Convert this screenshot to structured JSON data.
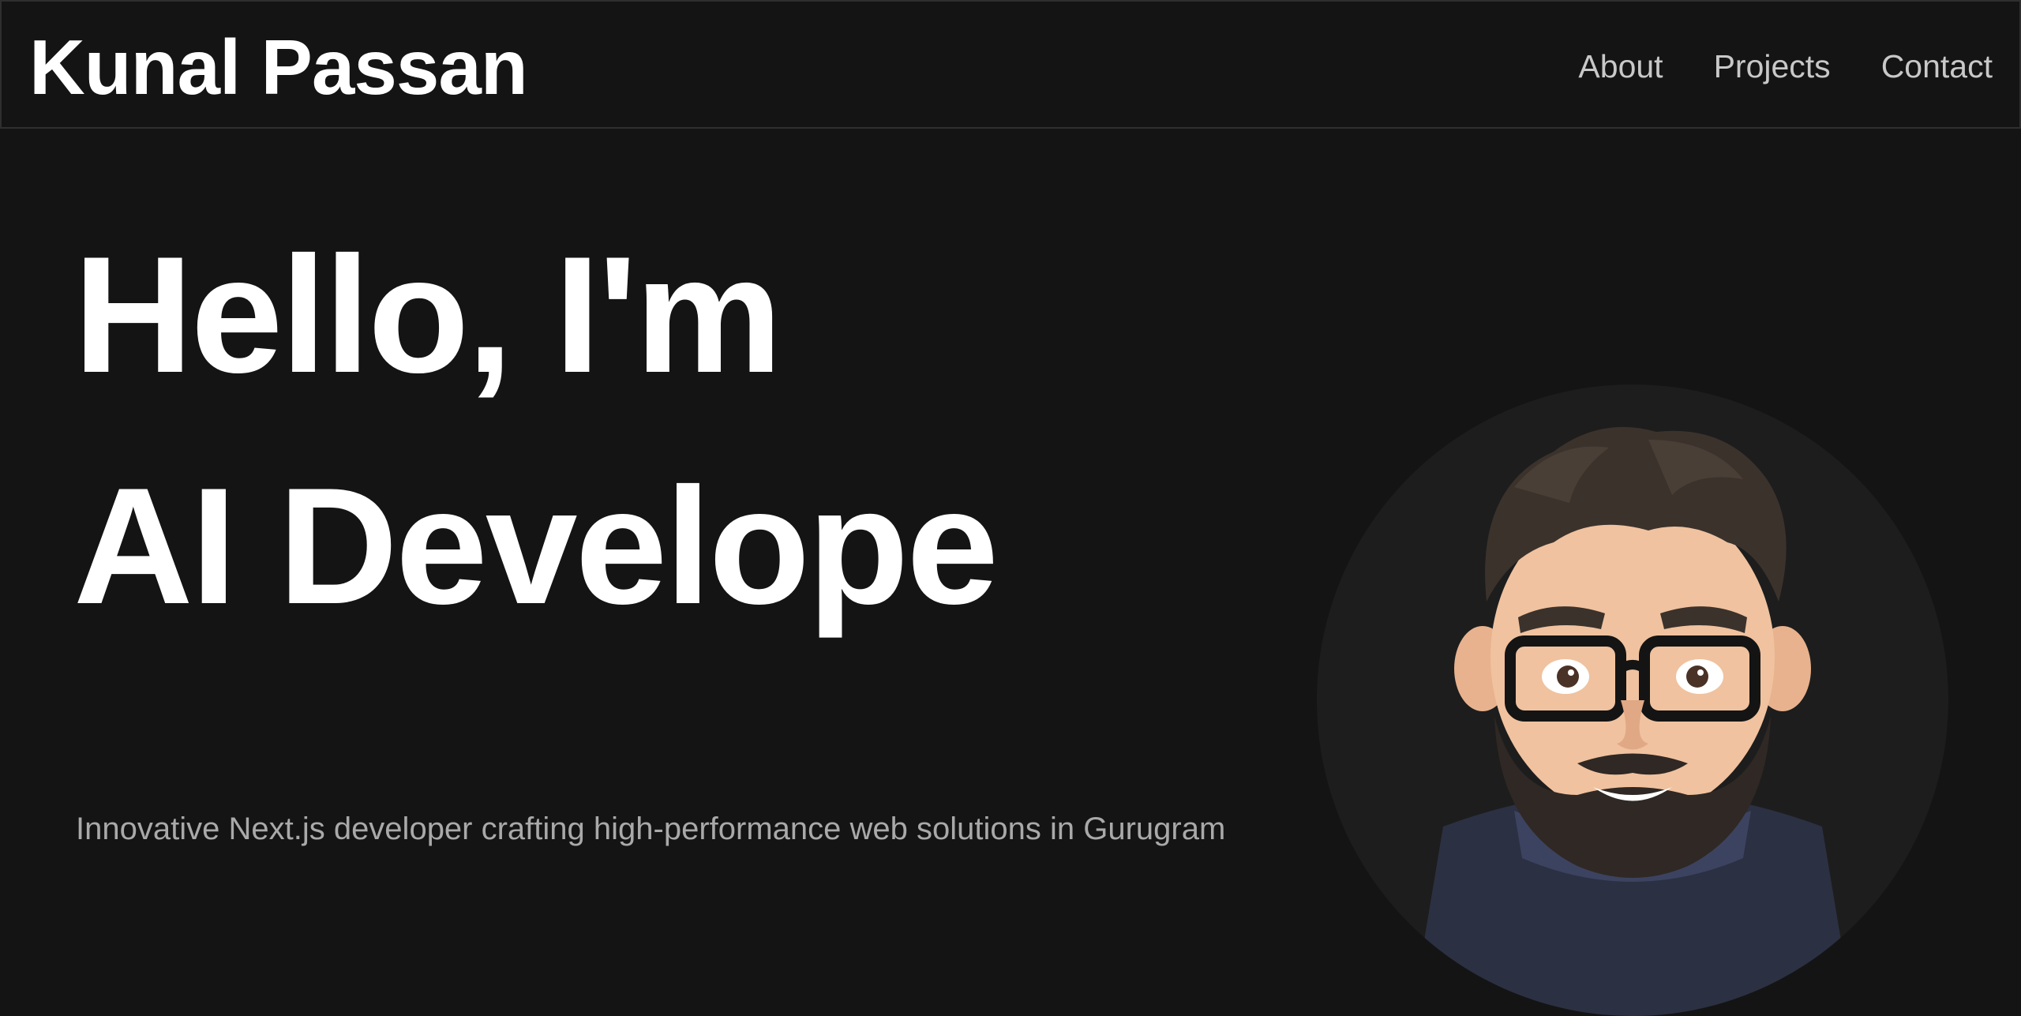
{
  "header": {
    "brand": "Kunal Passan",
    "nav": [
      {
        "label": "About"
      },
      {
        "label": "Projects"
      },
      {
        "label": "Contact"
      }
    ]
  },
  "hero": {
    "headline_line1": "Hello, I'm",
    "headline_line2": "AI Develope",
    "subtitle": "Innovative Next.js developer crafting high-performance web solutions in Gurugram"
  },
  "avatar": {
    "icon": "cartoon-avatar-icon"
  },
  "colors": {
    "background": "#141414",
    "text_primary": "#ffffff",
    "nav_text": "#c8c8c8",
    "subtitle_text": "#a9a9a9",
    "avatar_circle": "#1d1d1d"
  }
}
